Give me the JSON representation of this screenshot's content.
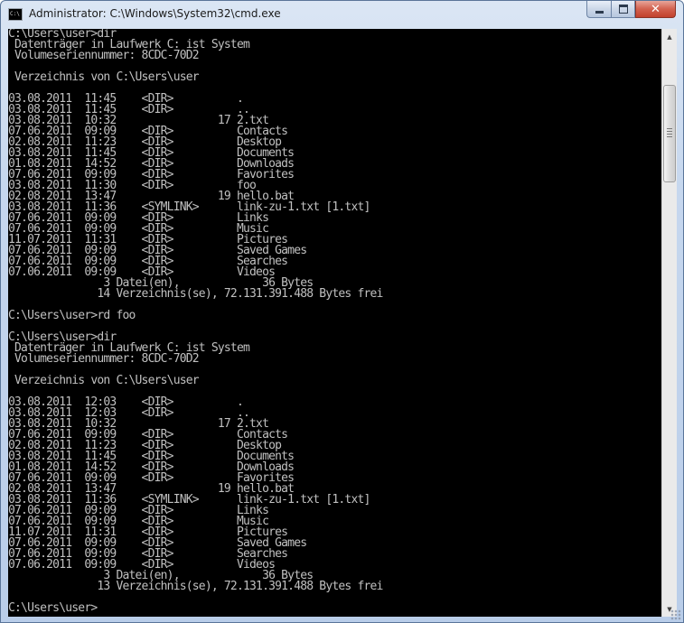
{
  "window": {
    "title": "Administrator: C:\\Windows\\System32\\cmd.exe",
    "icon_label": "C:\\",
    "minimize_label": "",
    "maximize_label": "",
    "close_label": "✕"
  },
  "console": {
    "lines": [
      "C:\\Users\\user>dir",
      " Datenträger in Laufwerk C: ist System",
      " Volumeseriennummer: 8CDC-70D2",
      "",
      " Verzeichnis von C:\\Users\\user",
      "",
      "03.08.2011  11:45    <DIR>          .",
      "03.08.2011  11:45    <DIR>          ..",
      "03.08.2011  10:32                17 2.txt",
      "07.06.2011  09:09    <DIR>          Contacts",
      "02.08.2011  11:23    <DIR>          Desktop",
      "03.08.2011  11:45    <DIR>          Documents",
      "01.08.2011  14:52    <DIR>          Downloads",
      "07.06.2011  09:09    <DIR>          Favorites",
      "03.08.2011  11:30    <DIR>          foo",
      "02.08.2011  13:47                19 hello.bat",
      "03.08.2011  11:36    <SYMLINK>      link-zu-1.txt [1.txt]",
      "07.06.2011  09:09    <DIR>          Links",
      "07.06.2011  09:09    <DIR>          Music",
      "11.07.2011  11:31    <DIR>          Pictures",
      "07.06.2011  09:09    <DIR>          Saved Games",
      "07.06.2011  09:09    <DIR>          Searches",
      "07.06.2011  09:09    <DIR>          Videos",
      "               3 Datei(en),             36 Bytes",
      "              14 Verzeichnis(se), 72.131.391.488 Bytes frei",
      "",
      "C:\\Users\\user>rd foo",
      "",
      "C:\\Users\\user>dir",
      " Datenträger in Laufwerk C: ist System",
      " Volumeseriennummer: 8CDC-70D2",
      "",
      " Verzeichnis von C:\\Users\\user",
      "",
      "03.08.2011  12:03    <DIR>          .",
      "03.08.2011  12:03    <DIR>          ..",
      "03.08.2011  10:32                17 2.txt",
      "07.06.2011  09:09    <DIR>          Contacts",
      "02.08.2011  11:23    <DIR>          Desktop",
      "03.08.2011  11:45    <DIR>          Documents",
      "01.08.2011  14:52    <DIR>          Downloads",
      "07.06.2011  09:09    <DIR>          Favorites",
      "02.08.2011  13:47                19 hello.bat",
      "03.08.2011  11:36    <SYMLINK>      link-zu-1.txt [1.txt]",
      "07.06.2011  09:09    <DIR>          Links",
      "07.06.2011  09:09    <DIR>          Music",
      "11.07.2011  11:31    <DIR>          Pictures",
      "07.06.2011  09:09    <DIR>          Saved Games",
      "07.06.2011  09:09    <DIR>          Searches",
      "07.06.2011  09:09    <DIR>          Videos",
      "               3 Datei(en),             36 Bytes",
      "              13 Verzeichnis(se), 72.131.391.488 Bytes frei",
      "",
      "C:\\Users\\user>"
    ]
  },
  "scrollbar": {
    "up_arrow": "▲",
    "down_arrow": "▼"
  },
  "colors": {
    "console_background": "#000000",
    "console_text": "#c0c0c0",
    "close_button": "#c7432f"
  }
}
